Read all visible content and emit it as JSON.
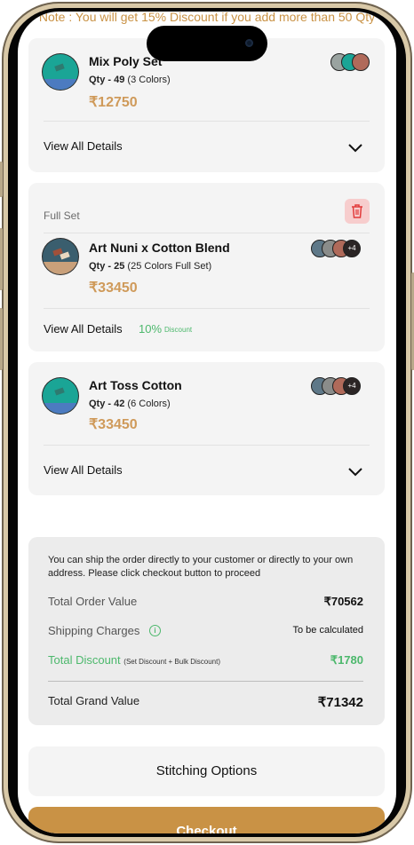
{
  "banner": {
    "note": "Note : You will get 15% Discount if you add more than 50 Qty"
  },
  "items": [
    {
      "name": "Mix Poly Set",
      "qty_label": "Qty - 49",
      "colors_label": "(3 Colors)",
      "price": "₹12750",
      "view_details": "View All Details",
      "thumb_color": "#1aa596",
      "swatches": [
        "#9aa3a0",
        "#1aa596",
        "#b06a5a"
      ]
    },
    {
      "set_label": "Full Set",
      "name": "Art Nuni x Cotton Blend",
      "qty_label": "Qty - 25",
      "colors_label": "(25 Colors Full Set)",
      "price": "₹33450",
      "view_details": "View All Details",
      "discount_pct": "10%",
      "discount_word": "Discount",
      "thumb_color": "#3a5e6e",
      "swatches": [
        "#5e7888",
        "#8a8c8a",
        "#b06a5a"
      ],
      "more": "+4"
    },
    {
      "name": "Art Toss Cotton",
      "qty_label": "Qty - 42",
      "colors_label": "(6 Colors)",
      "price": "₹33450",
      "view_details": "View All Details",
      "thumb_color": "#1aa596",
      "swatches": [
        "#5e7888",
        "#8a8c8a",
        "#b06a5a"
      ],
      "more": "+4"
    }
  ],
  "summary": {
    "note": "You can ship the order directly to your customer or directly to your own address. Please click checkout button to proceed",
    "total_order_label": "Total Order Value",
    "total_order_value": "₹70562",
    "shipping_label": "Shipping Charges",
    "shipping_value": "To be calculated",
    "discount_label": "Total Discount",
    "discount_sub": "(Set Discount + Bulk Discount)",
    "discount_value": "₹1780",
    "grand_label": "Total Grand Value",
    "grand_value": "₹71342"
  },
  "actions": {
    "stitching": "Stitching Options",
    "checkout": "Checkout"
  },
  "colors": {
    "accent": "#c99245",
    "green": "#4cb86c",
    "danger_bg": "#f7cdcd"
  }
}
